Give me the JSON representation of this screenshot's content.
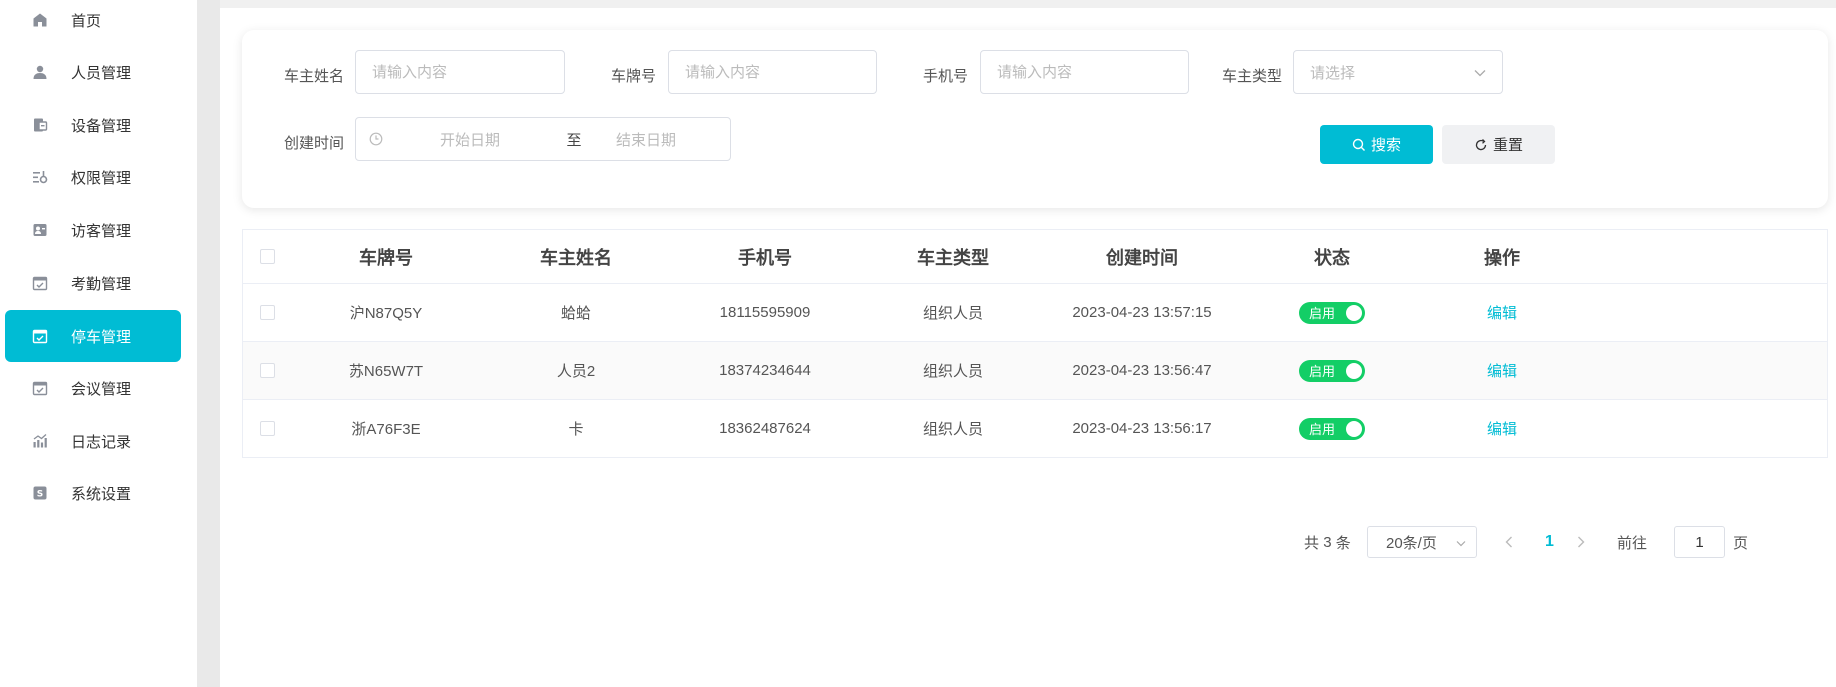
{
  "sidebar": {
    "items": [
      {
        "label": "首页",
        "icon": "home-icon"
      },
      {
        "label": "人员管理",
        "icon": "user-icon"
      },
      {
        "label": "设备管理",
        "icon": "device-icon"
      },
      {
        "label": "权限管理",
        "icon": "permission-icon"
      },
      {
        "label": "访客管理",
        "icon": "visitor-icon"
      },
      {
        "label": "考勤管理",
        "icon": "calendar-check-icon"
      },
      {
        "label": "停车管理",
        "icon": "calendar-check-icon",
        "active": true
      },
      {
        "label": "会议管理",
        "icon": "calendar-check-icon"
      },
      {
        "label": "日志记录",
        "icon": "chart-icon"
      },
      {
        "label": "系统设置",
        "icon": "settings-icon"
      }
    ]
  },
  "search": {
    "owner_name_label": "车主姓名",
    "owner_name_placeholder": "请输入内容",
    "plate_label": "车牌号",
    "plate_placeholder": "请输入内容",
    "phone_label": "手机号",
    "phone_placeholder": "请输入内容",
    "owner_type_label": "车主类型",
    "owner_type_placeholder": "请选择",
    "created_label": "创建时间",
    "start_placeholder": "开始日期",
    "range_separator": "至",
    "end_placeholder": "结束日期",
    "search_button": "搜索",
    "reset_button": "重置"
  },
  "table": {
    "columns": [
      "车牌号",
      "车主姓名",
      "手机号",
      "车主类型",
      "创建时间",
      "状态",
      "操作"
    ],
    "rows": [
      {
        "plate": "沪N87Q5Y",
        "name": "蛤蛤",
        "phone": "18115595909",
        "type": "组织人员",
        "created": "2023-04-23 13:57:15",
        "status": "启用",
        "action": "编辑"
      },
      {
        "plate": "苏N65W7T",
        "name": "人员2",
        "phone": "18374234644",
        "type": "组织人员",
        "created": "2023-04-23 13:56:47",
        "status": "启用",
        "action": "编辑"
      },
      {
        "plate": "浙A76F3E",
        "name": "卡",
        "phone": "18362487624",
        "type": "组织人员",
        "created": "2023-04-23 13:56:17",
        "status": "启用",
        "action": "编辑"
      }
    ]
  },
  "pagination": {
    "total_prefix": "共",
    "total": "3",
    "total_suffix": "条",
    "page_size": "20条/页",
    "current_page": "1",
    "goto_prefix": "前往",
    "goto_value": "1",
    "goto_suffix": "页"
  },
  "colors": {
    "accent": "#00bcd4",
    "switch_on": "#13ce66"
  }
}
